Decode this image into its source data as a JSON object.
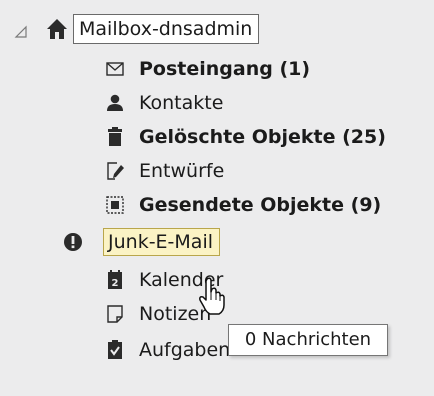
{
  "root": {
    "label": "Mailbox-dnsadmin",
    "icon": "home-icon",
    "expander_icon": "collapse-triangle-icon"
  },
  "folders": [
    {
      "label": "Posteingang (1)",
      "icon": "envelope-icon",
      "bold": true
    },
    {
      "label": "Kontakte",
      "icon": "person-icon",
      "bold": false
    },
    {
      "label": "Gelöschte Objekte (25)",
      "icon": "trash-icon",
      "bold": true
    },
    {
      "label": "Entwürfe",
      "icon": "draft-pencil-icon",
      "bold": false
    },
    {
      "label": "Gesendete Objekte (9)",
      "icon": "sent-items-icon",
      "bold": true
    },
    {
      "label": "Junk-E-Mail",
      "icon": "exclamation-icon",
      "bold": false,
      "hovered": true
    },
    {
      "label": "Kalender",
      "icon": "calendar-icon",
      "bold": false
    },
    {
      "label": "Notizen",
      "icon": "note-icon",
      "bold": false
    },
    {
      "label": "Aufgaben",
      "icon": "task-clipboard-icon",
      "bold": false
    }
  ],
  "tooltip": {
    "text": "0 Nachrichten"
  },
  "cursor": {
    "icon": "hand-pointer-icon"
  },
  "colors": {
    "background": "#ececed",
    "icon": "#2b2b2b",
    "hover_fill": "#fbf3c5",
    "hover_border": "#b9a64b",
    "selection_border": "#6a6a6a"
  }
}
